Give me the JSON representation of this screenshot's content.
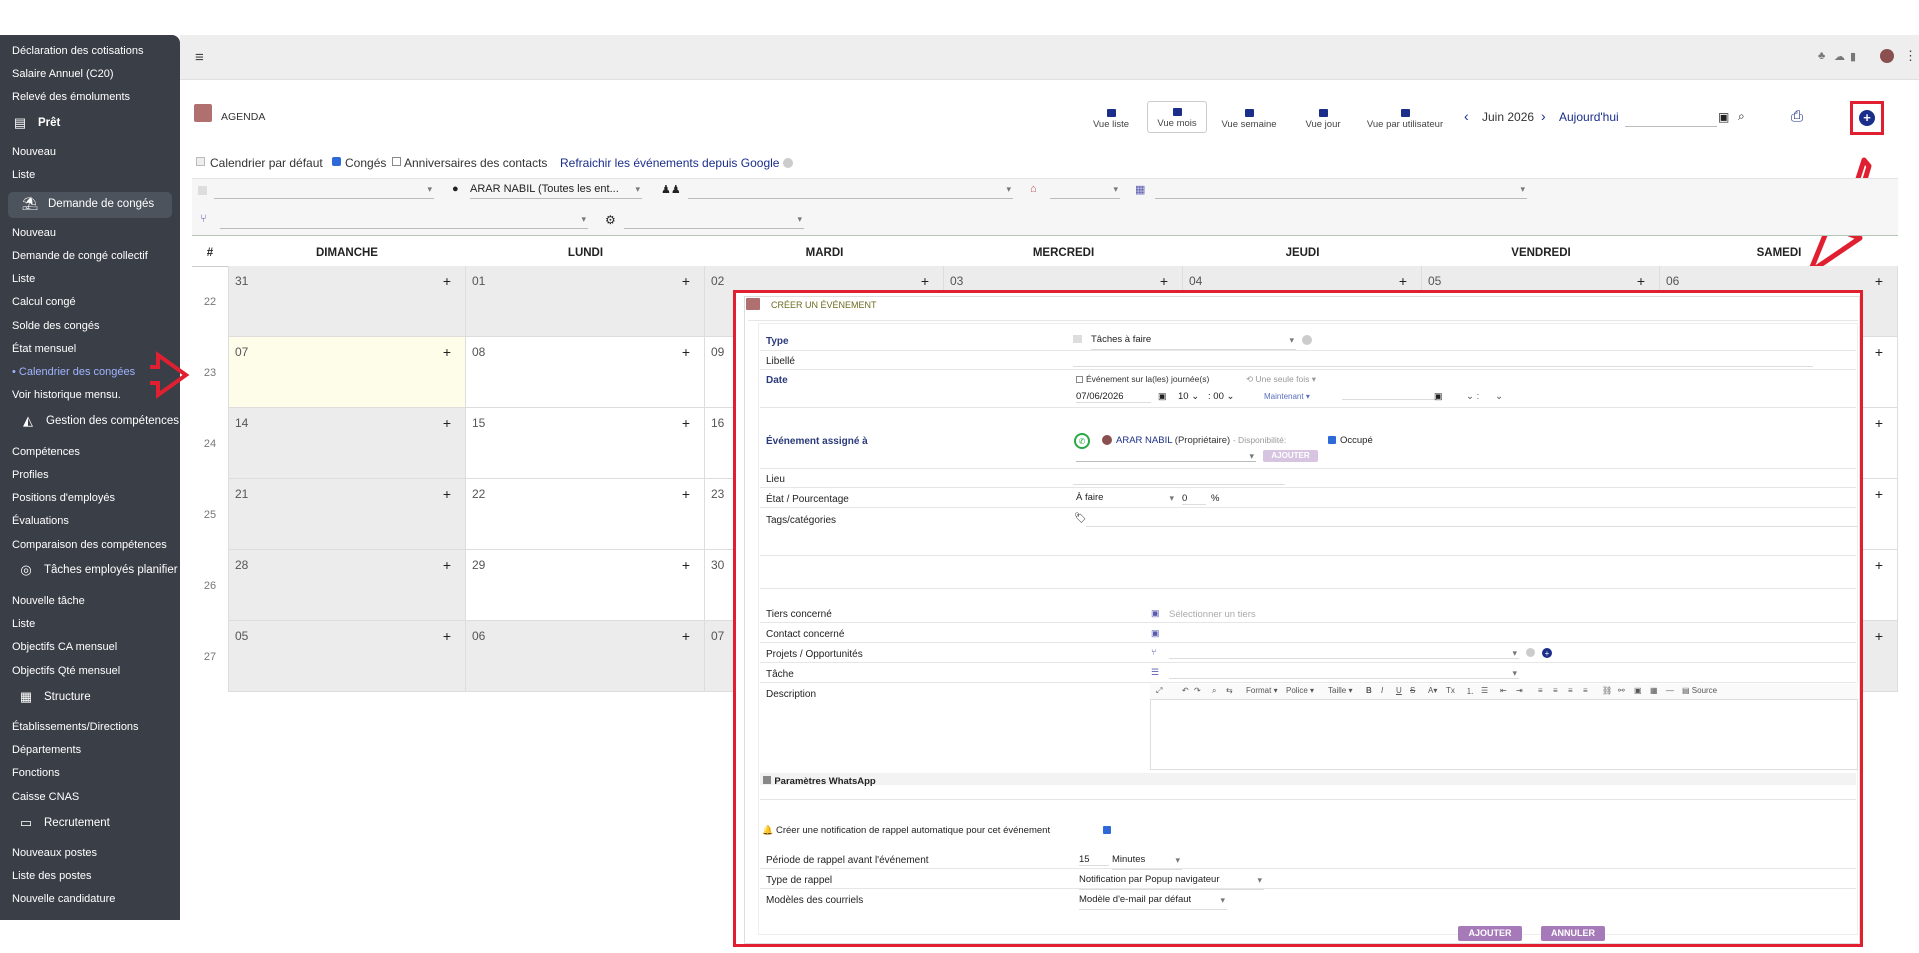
{
  "sidebar": {
    "items": [
      {
        "label": "Déclaration des cotisations"
      },
      {
        "label": "Salaire Annuel (C20)"
      },
      {
        "label": "Relevé des émoluments"
      },
      {
        "label": "Prêt"
      },
      {
        "label": "Nouveau"
      },
      {
        "label": "Liste"
      },
      {
        "label": "Demande de congés"
      },
      {
        "label": "Nouveau"
      },
      {
        "label": "Demande de congé collectif"
      },
      {
        "label": "Liste"
      },
      {
        "label": "Calcul congé"
      },
      {
        "label": "Solde des congés"
      },
      {
        "label": "État mensuel"
      },
      {
        "label": "Calendrier des congées"
      },
      {
        "label": "Voir historique mensu."
      },
      {
        "label": "Gestion des compétences"
      },
      {
        "label": "Compétences"
      },
      {
        "label": "Profiles"
      },
      {
        "label": "Positions d'employés"
      },
      {
        "label": "Évaluations"
      },
      {
        "label": "Comparaison des compétences"
      },
      {
        "label": "Tâches employés planifier"
      },
      {
        "label": "Nouvelle tâche"
      },
      {
        "label": "Liste"
      },
      {
        "label": "Objectifs CA mensuel"
      },
      {
        "label": "Objectifs Qté mensuel"
      },
      {
        "label": "Structure"
      },
      {
        "label": "Établissements/Directions"
      },
      {
        "label": "Départements"
      },
      {
        "label": "Fonctions"
      },
      {
        "label": "Caisse CNAS"
      },
      {
        "label": "Recrutement"
      },
      {
        "label": "Nouveaux postes"
      },
      {
        "label": "Liste des postes"
      },
      {
        "label": "Nouvelle candidature"
      }
    ]
  },
  "page": {
    "title": "AGENDA",
    "views": [
      {
        "label": "Vue liste"
      },
      {
        "label": "Vue mois"
      },
      {
        "label": "Vue semaine"
      },
      {
        "label": "Vue jour"
      },
      {
        "label": "Vue par utilisateur"
      }
    ],
    "period": "Juin 2026",
    "today": "Aujourd'hui",
    "filters": {
      "default_calendar": "Calendrier par défaut",
      "conges": "Congés",
      "anniversaires": "Anniversaires des contacts",
      "refresh": "Refraichir les événements depuis Google",
      "user": "ARAR NABIL (Toutes les ent..."
    }
  },
  "calendar": {
    "hash": "#",
    "days": [
      "DIMANCHE",
      "LUNDI",
      "MARDI",
      "MERCREDI",
      "JEUDI",
      "VENDREDI",
      "SAMEDI"
    ],
    "weeks": [
      {
        "wk": "22",
        "d": [
          "31",
          "01",
          "02",
          "03",
          "04",
          "05",
          "06"
        ]
      },
      {
        "wk": "23",
        "d": [
          "07",
          "08",
          "09",
          "",
          "",
          "",
          ""
        ]
      },
      {
        "wk": "24",
        "d": [
          "14",
          "15",
          "16",
          "",
          "",
          "",
          ""
        ]
      },
      {
        "wk": "25",
        "d": [
          "21",
          "22",
          "23",
          "",
          "",
          "",
          ""
        ]
      },
      {
        "wk": "26",
        "d": [
          "28",
          "29",
          "30",
          "",
          "",
          "",
          ""
        ]
      },
      {
        "wk": "27",
        "d": [
          "05",
          "06",
          "07",
          "",
          "",
          "",
          ""
        ]
      }
    ],
    "plus": "+"
  },
  "modal": {
    "title": "CRÉER UN ÉVÉNEMENT",
    "type_label": "Type",
    "type_value": "Tâches à faire",
    "libelle_label": "Libellé",
    "date_label": "Date",
    "allday": "Événement sur la(les) journée(s)",
    "repeat": "Une seule fois",
    "date_value": "07/06/2026",
    "hour": "10",
    "minute": "00",
    "now": "Maintenant",
    "time2": ":",
    "assigned_label": "Événement assigné à",
    "assigned_user": "ARAR NABIL",
    "assigned_role": "(Propriétaire)",
    "dispo": "- Disponibilité:",
    "occupe": "Occupé",
    "ajouter_small": "AJOUTER",
    "lieu_label": "Lieu",
    "etat_label": "État / Pourcentage",
    "etat_value": "À faire",
    "pct_value": "0",
    "pct_sign": "%",
    "tags_label": "Tags/catégories",
    "tiers_label": "Tiers concerné",
    "tiers_placeholder": "Sélectionner un tiers",
    "contact_label": "Contact concerné",
    "projets_label": "Projets / Opportunités",
    "tache_label": "Tâche",
    "desc_label": "Description",
    "editor": {
      "format": "Format",
      "police": "Police",
      "taille": "Taille",
      "source": "Source"
    },
    "whatsapp": "Paramètres WhatsApp",
    "reminder": "Créer une notification de rappel automatique pour cet événement",
    "periode_label": "Période de rappel avant l'événement",
    "periode_value": "15",
    "periode_unit": "Minutes",
    "type_rappel_label": "Type de rappel",
    "type_rappel_value": "Notification par Popup navigateur",
    "modeles_label": "Modèles des courriels",
    "modeles_value": "Modèle d'e-mail par défaut",
    "btn_ajouter": "AJOUTER",
    "btn_annuler": "ANNULER"
  },
  "colors": {
    "sidebar": "#3a3f47",
    "accent": "#1a2e8a",
    "annotation": "#e02030",
    "purple": "#a67ab8",
    "agenda_icon": "#b07070"
  }
}
